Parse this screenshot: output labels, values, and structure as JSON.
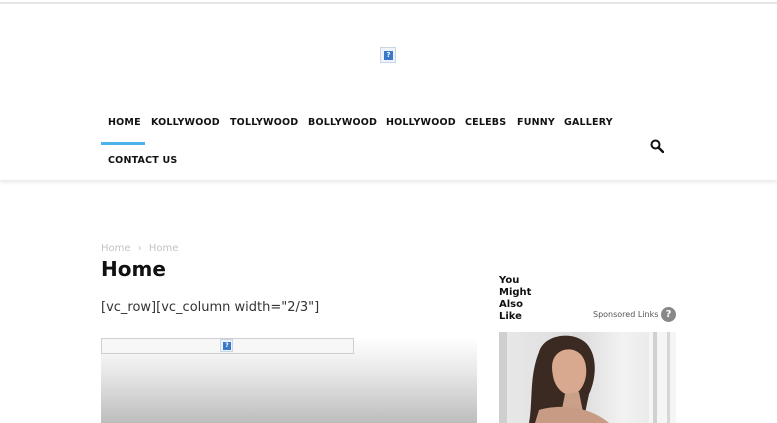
{
  "header": {
    "logo_alt": "?",
    "nav": {
      "items": [
        {
          "label": "HOME"
        },
        {
          "label": "KOLLYWOOD"
        },
        {
          "label": "TOLLYWOOD"
        },
        {
          "label": "BOLLYWOOD"
        },
        {
          "label": "HOLLYWOOD"
        },
        {
          "label": "CELEBS"
        },
        {
          "label": "FUNNY"
        },
        {
          "label": "GALLERY"
        },
        {
          "label": "CONTACT US"
        }
      ],
      "active_index": 0,
      "accent_color": "#4db2ec"
    },
    "search_icon": "search-icon"
  },
  "breadcrumb": [
    "Home",
    "›",
    "Home"
  ],
  "page": {
    "title": "Home",
    "shortcode_text": "[vc_row][vc_column width=\"2/3\"]",
    "broken_image_alt": "?"
  },
  "sidebar": {
    "title": "You Might Also Like",
    "sponsored_label": "Sponsored Links",
    "help_label": "?"
  }
}
